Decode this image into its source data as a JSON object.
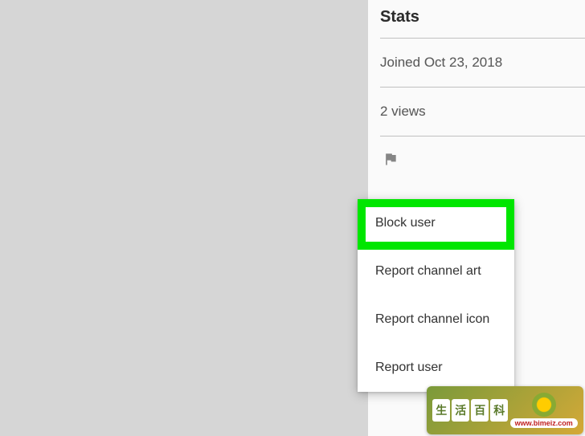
{
  "sidebar": {
    "heading": "Stats",
    "joined": "Joined Oct 23, 2018",
    "views": "2 views"
  },
  "dropdown": {
    "items": [
      "Block user",
      "Report channel art",
      "Report channel icon",
      "Report user"
    ]
  },
  "watermark": {
    "chars": [
      "生",
      "活",
      "百",
      "科"
    ],
    "url": "www.bimeiz.com"
  }
}
